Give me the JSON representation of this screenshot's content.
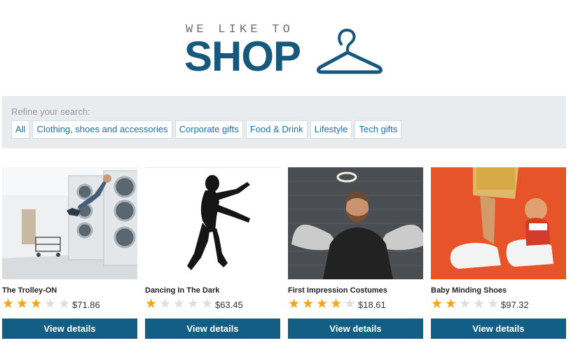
{
  "logo": {
    "tagline": "WE LIKE TO",
    "word": "SHOP"
  },
  "refine": {
    "title": "Refine your search:",
    "filters": [
      "All",
      "Clothing, shoes and accessories",
      "Corporate gifts",
      "Food & Drink",
      "Lifestyle",
      "Tech gifts"
    ]
  },
  "products": [
    {
      "name": "The Trolley-ON",
      "rating": 3,
      "max_rating": 5,
      "price": "$71.86",
      "button": "View details"
    },
    {
      "name": "Dancing In The Dark",
      "rating": 1,
      "max_rating": 5,
      "price": "$63.45",
      "button": "View details"
    },
    {
      "name": "First Impression Costumes",
      "rating": 4,
      "max_rating": 5,
      "price": "$18.61",
      "button": "View details"
    },
    {
      "name": "Baby Minding Shoes",
      "rating": 2,
      "max_rating": 5,
      "price": "$97.32",
      "button": "View details"
    }
  ],
  "colors": {
    "brand": "#17587d",
    "button": "#135e85",
    "star": "#f5a31a",
    "link": "#1b6fa8"
  }
}
